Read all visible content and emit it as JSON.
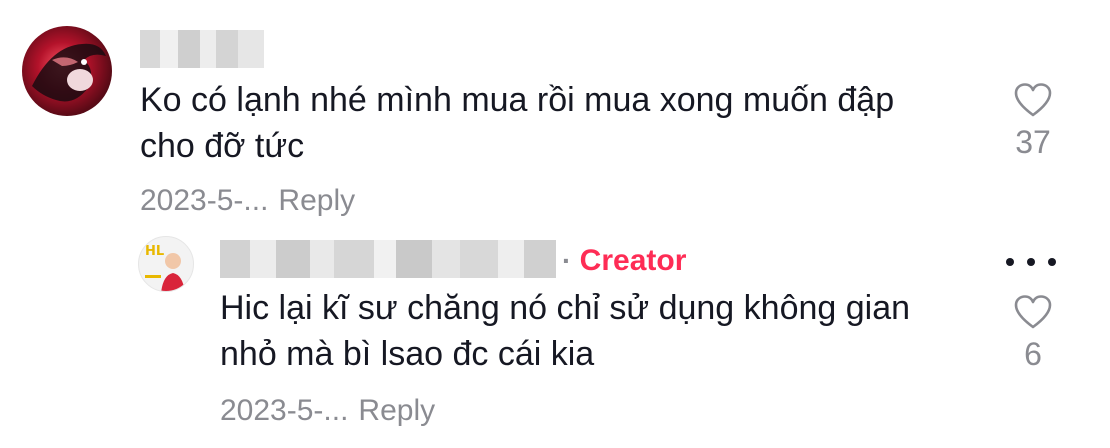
{
  "comment": {
    "text_line1": "Ko có lạnh nhé mình mua rồi mua xong muốn đập",
    "text_line2": "cho đỡ tức",
    "date": "2023-5-...",
    "reply_label": "Reply",
    "like_count": "37"
  },
  "reply": {
    "separator": "·",
    "badge": "Creator",
    "text_line1": "Hic lại kĩ sư chăng nó chỉ sử dụng không gian",
    "text_line2": "nhỏ mà bì lsao đc cái kia",
    "date": "2023-5-...",
    "reply_label": "Reply",
    "like_count": "6"
  },
  "colors": {
    "text": "#161823",
    "muted": "#8a8b91",
    "creator": "#fe2c55"
  },
  "icons": {
    "like": "heart-outline-icon",
    "more": "more-horizontal-icon"
  }
}
